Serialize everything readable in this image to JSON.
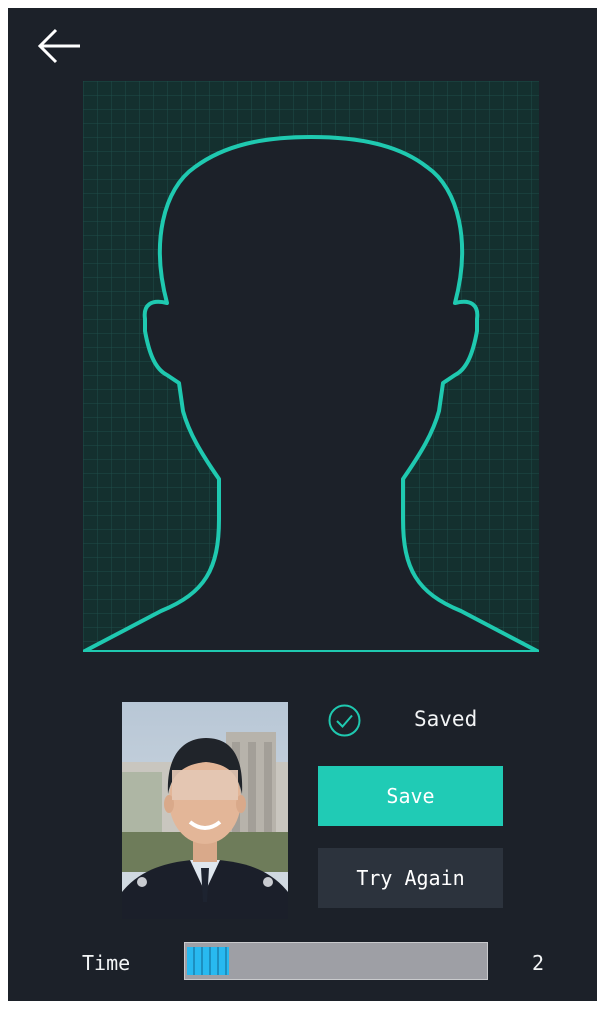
{
  "header": {
    "back_icon": "arrow-left-icon"
  },
  "capture": {
    "outline_icon": "head-shoulders-outline-icon",
    "accent_color": "#1fc9b0",
    "grid_color": "#1e4d48",
    "background_color": "#14302f"
  },
  "captured_photo": {
    "kind": "face-photo"
  },
  "status": {
    "icon": "check-circle-icon",
    "text": "Saved"
  },
  "actions": {
    "save_label": "Save",
    "try_again_label": "Try Again"
  },
  "timer": {
    "label": "Time",
    "value": "2",
    "progress_fraction": 0.14,
    "fill_color": "#28b9f0"
  }
}
